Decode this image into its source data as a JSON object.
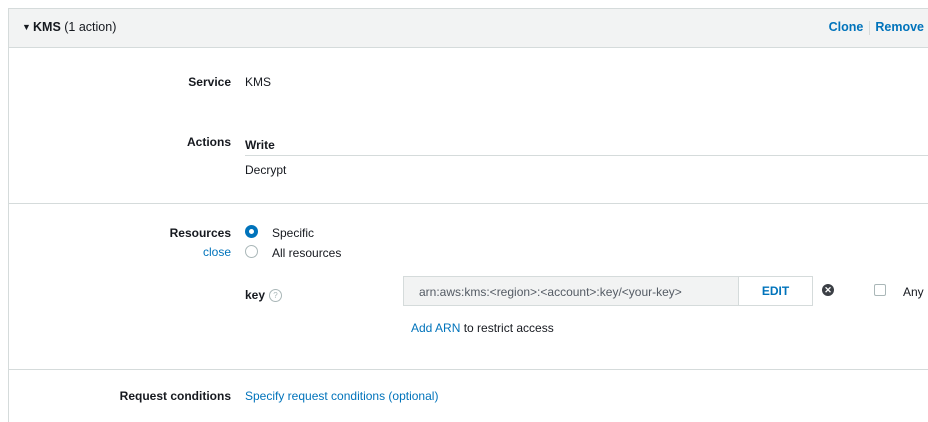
{
  "header": {
    "service_name": "KMS",
    "action_count": "(1 action)",
    "clone_label": "Clone",
    "remove_label": "Remove"
  },
  "service": {
    "label": "Service",
    "value": "KMS"
  },
  "actions": {
    "label": "Actions",
    "group_heading": "Write",
    "items": [
      "Decrypt"
    ]
  },
  "resources": {
    "label": "Resources",
    "close_label": "close",
    "options": [
      "Specific",
      "All resources"
    ],
    "selected": "Specific",
    "key_label": "key",
    "help_icon": "question-circle-icon",
    "arn_value": "arn:aws:kms:<region>:<account>:key/<your-key>",
    "edit_label": "EDIT",
    "remove_icon": "x-circle-icon",
    "any_label": "Any",
    "add_arn_link": "Add ARN",
    "add_arn_suffix": " to restrict access"
  },
  "request_conditions": {
    "label": "Request conditions",
    "link": "Specify request conditions (optional)"
  },
  "colors": {
    "accent": "#0073bb",
    "header_bg": "#f2f3f3",
    "border": "#d5dbdb"
  }
}
